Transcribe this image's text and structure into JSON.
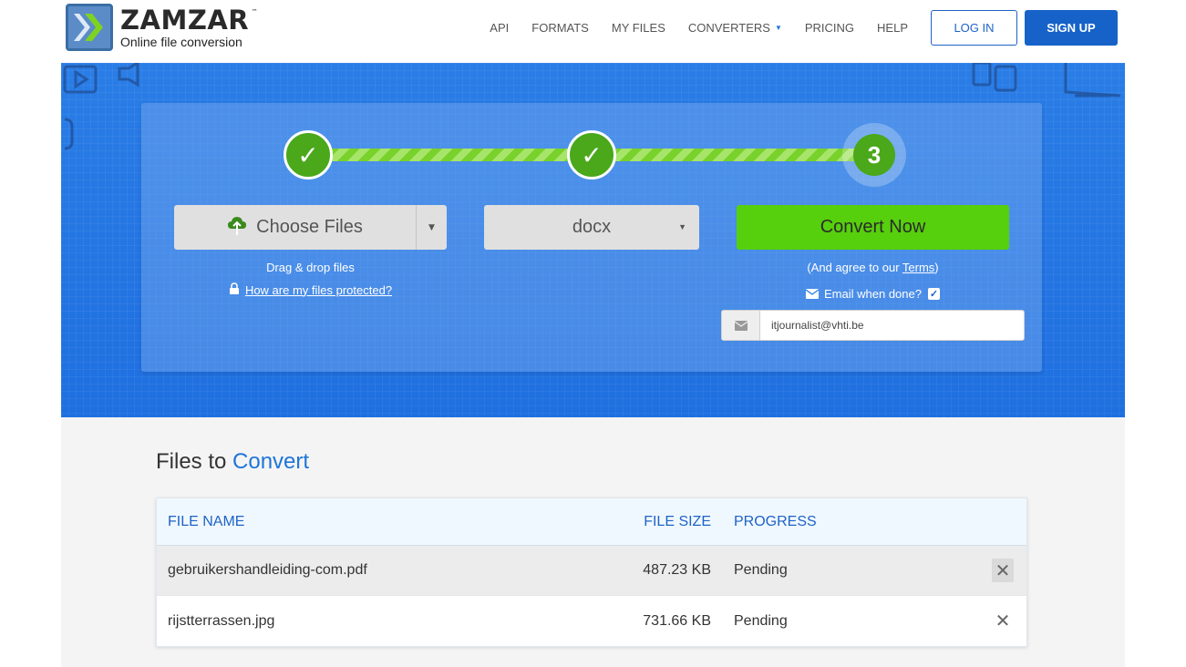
{
  "brand": {
    "name": "ZAMZAR",
    "tm": "™",
    "tagline": "Online file conversion"
  },
  "nav": {
    "items": [
      "API",
      "FORMATS",
      "MY FILES",
      "CONVERTERS",
      "PRICING",
      "HELP"
    ],
    "login": "LOG IN",
    "signup": "SIGN UP"
  },
  "steps": {
    "step1_mark": "✓",
    "step2_mark": "✓",
    "step3_label": "3"
  },
  "upload": {
    "choose_label": "Choose Files",
    "drag_text": "Drag & drop files",
    "protect_link": "How are my files protected?"
  },
  "format": {
    "selected": "docx"
  },
  "convert": {
    "button": "Convert Now",
    "agree_prefix": "(And agree to our ",
    "terms": "Terms",
    "agree_suffix": ")",
    "email_when": "Email when done?",
    "email_checked": true,
    "email_value": "itjournalist@vhti.be"
  },
  "files": {
    "title_a": "Files to",
    "title_b": "Convert",
    "headers": {
      "name": "FILE NAME",
      "size": "FILE SIZE",
      "progress": "PROGRESS"
    },
    "rows": [
      {
        "name": "gebruikershandleiding-com.pdf",
        "size": "487.23 KB",
        "progress": "Pending"
      },
      {
        "name": "rijstterrassen.jpg",
        "size": "731.66 KB",
        "progress": "Pending"
      }
    ]
  },
  "colors": {
    "brand_blue": "#1662c8",
    "hero_blue": "#2a7de6",
    "convert_green": "#56cf0c",
    "step_green": "#4aa81a"
  },
  "icons": [
    "logo-chevrons-icon",
    "upload-cloud-icon",
    "lock-icon",
    "envelope-icon",
    "checkbox-icon",
    "close-icon",
    "caret-down-icon"
  ]
}
